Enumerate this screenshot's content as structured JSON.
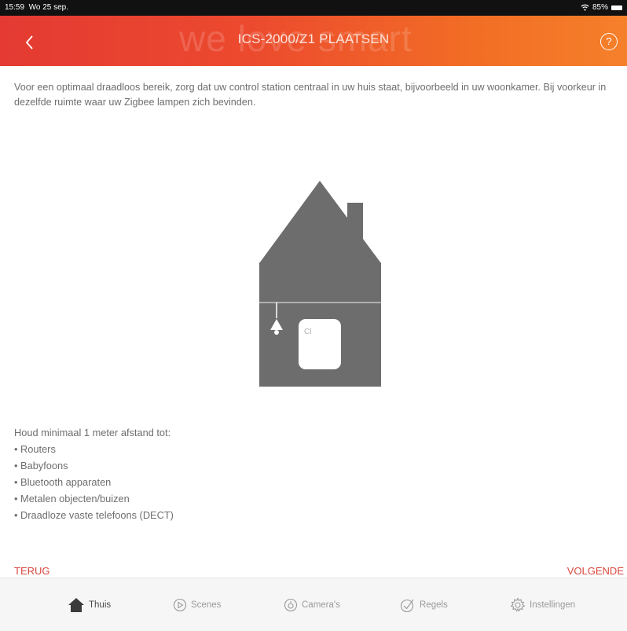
{
  "status_bar": {
    "time": "15:59",
    "date": "Wo 25 sep.",
    "battery": "85%",
    "wifi_icon": "wifi-icon"
  },
  "header": {
    "title": "ICS-2000/Z1 PLAATSEN",
    "watermark": "we love smart",
    "help_label": "?",
    "back_icon": "chevron-left-icon"
  },
  "intro_text": "Voor een optimaal draadloos bereik, zorg dat uw control station centraal in uw huis staat, bijvoorbeeld in uw woonkamer. Bij voorkeur in dezelfde ruimte waar uw Zigbee lampen zich bevinden.",
  "illustration": {
    "device_label": "Cl"
  },
  "hint": {
    "heading": "Houd minimaal 1 meter afstand tot:",
    "items": [
      "• Routers",
      "• Babyfoons",
      "• Bluetooth apparaten",
      "• Metalen objecten/buizen",
      "• Draadloze vaste telefoons (DECT)"
    ]
  },
  "actions": {
    "back": "TERUG",
    "next": "VOLGENDE"
  },
  "tabs": [
    {
      "label": "Thuis",
      "icon": "home-icon",
      "active": true
    },
    {
      "label": "Scenes",
      "icon": "play-circle-icon",
      "active": false
    },
    {
      "label": "Camera's",
      "icon": "camera-icon",
      "active": false
    },
    {
      "label": "Regels",
      "icon": "rules-check-icon",
      "active": false
    },
    {
      "label": "Instellingen",
      "icon": "gear-icon",
      "active": false
    }
  ],
  "colors": {
    "accent": "#d9473d",
    "header_start": "#e43a33",
    "header_end": "#f5802a",
    "house": "#6d6d6d"
  }
}
